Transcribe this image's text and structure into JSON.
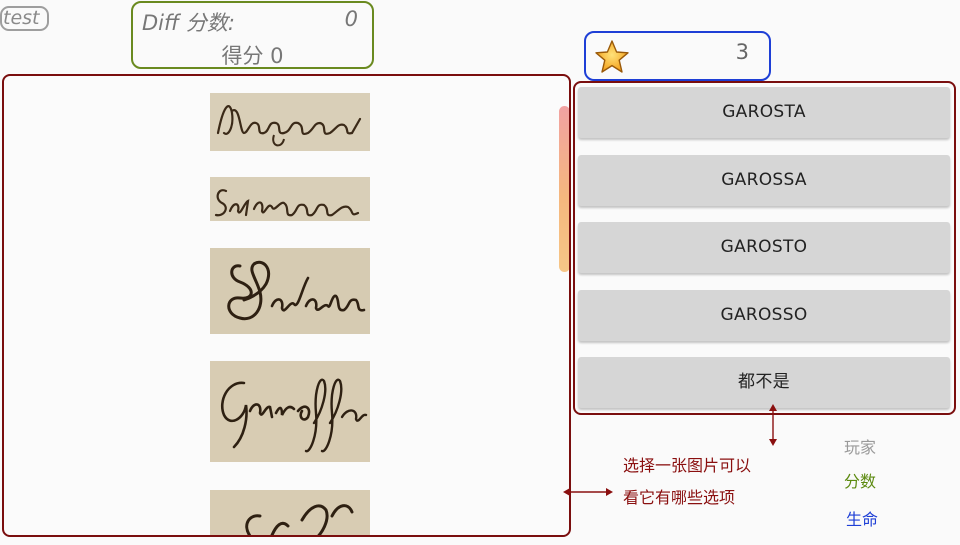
{
  "player": {
    "name": "test"
  },
  "score": {
    "diff_label": "Diff 分数:",
    "diff_value": "0",
    "score_text": "得分 0"
  },
  "lives": {
    "icon": "star-icon",
    "value": "3"
  },
  "image_list": {
    "items": [
      {
        "word": "Massaguer"
      },
      {
        "word": "Salanova"
      },
      {
        "word": "Badia"
      },
      {
        "word": "Garossa"
      },
      {
        "word": "Coll"
      }
    ]
  },
  "options": [
    "GAROSTA",
    "GAROSSA",
    "GAROSTO",
    "GAROSSO",
    "都不是"
  ],
  "hint": {
    "line1": "选择一张图片可以",
    "line2": "看它有哪些选项"
  },
  "legend": {
    "player": "玩家",
    "score": "分数",
    "lives": "生命"
  },
  "colors": {
    "player": "#9e9e9e",
    "score": "#6a8a1f",
    "lives": "#1e3fd6",
    "panel": "#7a0e0e"
  }
}
